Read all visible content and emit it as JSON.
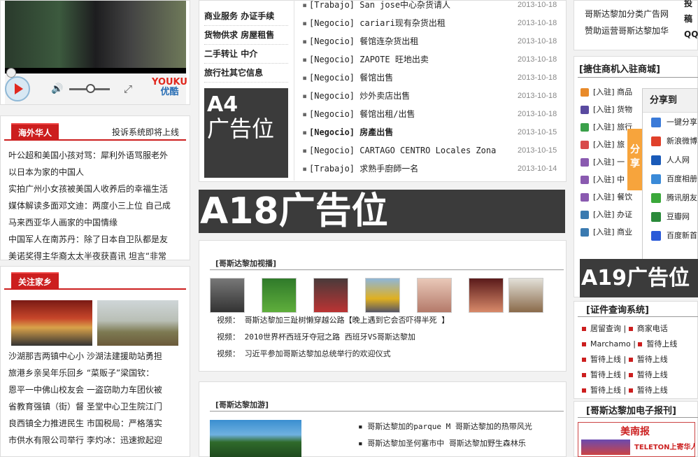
{
  "video_player": {
    "brand": "YOUKU",
    "brand_cn": "优酷"
  },
  "left_top_lines": [
    "投",
    "稿",
    "QQ"
  ],
  "overseas": {
    "tab": "海外华人",
    "right_link": "投诉系统即将上线",
    "items": [
      "叶公超和美国小孩对骂：犀利外语骂服老外",
      "以日本为家的中国人",
      "实拍广州小女孩被美国人收养后的幸福生活",
      "媒体解读多面邓文迪：两度小三上位 自己成",
      "马来西亚华人画家的中国情缘",
      "中国军人在南苏丹：除了日本自卫队都是友",
      "美诺奖得主华裔太太半夜获喜讯 坦言“非常"
    ]
  },
  "hometown": {
    "tab": "关注家乡",
    "items": [
      "沙湖那吉两镇中心小 沙湖法建援助站勇担",
      "旅港乡亲吴年乐回乡 “菜贩子”梁国钦：",
      "恩平一中佛山校友会 一盗窃助力车团伙被",
      "省教育强镇（街）督 圣堂中心卫生院江门",
      "良西镇全力推进民生 市国税局：严格落实",
      "市供水有限公司举行 李灼冰：迅速掀起迎"
    ]
  },
  "nav": [
    [
      "商业服务",
      "办证手续"
    ],
    [
      "货物供求",
      "房屋租售"
    ],
    [
      "二手转让",
      "中介"
    ],
    [
      "旅行社其它信息",
      ""
    ]
  ],
  "ad_a4": {
    "line1": "A4",
    "line2": "广告位"
  },
  "news": [
    {
      "title": "[Trabajo] San jose中心杂货请人",
      "date": "2013-10-18"
    },
    {
      "title": "[Negocio] cariari现有杂货出租",
      "date": "2013-10-18"
    },
    {
      "title": "[Negocio] 餐馆连杂货出租",
      "date": "2013-10-18"
    },
    {
      "title": "[Negocio] ZAPOTE 旺地出卖",
      "date": "2013-10-18"
    },
    {
      "title": "[Negocio] 餐馆出售",
      "date": "2013-10-18"
    },
    {
      "title": "[Negocio] 炒外卖店出售",
      "date": "2013-10-18"
    },
    {
      "title": "[Negocio] 餐馆出租/出售",
      "date": "2013-10-18"
    },
    {
      "title": "[Negocio] 房產出售",
      "date": "2013-10-15"
    },
    {
      "title": "[Negocio] CARTAGO CENTRO Locales Zona",
      "date": "2013-10-15"
    },
    {
      "title": "[Trabajo] 求熟手廚師一名",
      "date": "2013-10-14"
    }
  ],
  "ad_a18": "A18广告位",
  "video_section": {
    "title": "[哥斯达黎加视播]",
    "items": [
      "视频： 哥斯达黎加三趾树懒穿越公路【晚上遇到它会否吓得半死 】",
      "视频： 2010世界杯西班牙夺冠之路 西班牙VS哥斯达黎加",
      "视频： 习近平参加哥斯达黎加总统举行的欢迎仪式"
    ]
  },
  "travel_section": {
    "title": "[哥斯达黎加游]",
    "items": [
      "哥斯达黎加的parque M 哥斯达黎加的热带风光",
      "哥斯达黎加圣何塞市中 哥斯达黎加野生森林乐"
    ]
  },
  "right_top_links": [
    "哥斯达黎加分类广告网",
    "赞助运营哥斯达黎加华"
  ],
  "merchants": {
    "title": "[搪住商机入驻商城]",
    "items": [
      "[入驻] 商品",
      "[入驻] 货物",
      "[入驻] 旅行",
      "[入驻] 旅",
      "[入驻] 一",
      "[入驻] 中",
      "[入驻] 餐饮",
      "[入驻] 办证",
      "[入驻] 商业"
    ]
  },
  "share": {
    "title": "分享到",
    "tab": "分享",
    "items": [
      "一键分享",
      "新浪微博",
      "人人网",
      "百度相册",
      "腾讯朋友",
      "豆瓣网",
      "百度新首"
    ]
  },
  "ad_a19": "A19广告位",
  "cert": {
    "title": "[证件查询系统]",
    "rows": [
      [
        "居留查询",
        "商家电话"
      ],
      [
        "Marchamo",
        "暂待上线"
      ],
      [
        "暂待上线",
        "暂待上线"
      ],
      [
        "暂待上线",
        "暂待上线"
      ],
      [
        "暂待上线",
        "暂待上线"
      ]
    ]
  },
  "epaper": {
    "title": "[哥斯达黎加电子报刊]",
    "paper_name": "美南报",
    "paper_line": "TELETON上寄华人"
  }
}
